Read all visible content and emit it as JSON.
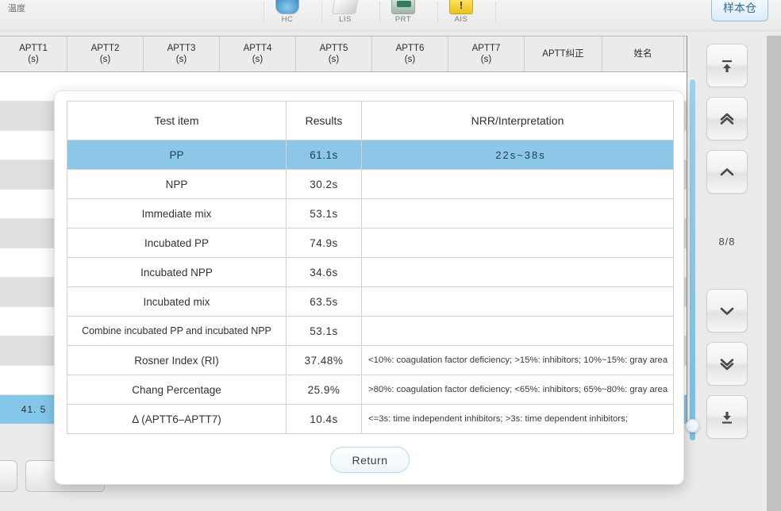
{
  "toolbar": {
    "left_label": "温度",
    "items": [
      {
        "name": "hc-icon",
        "label": "HC"
      },
      {
        "name": "lis-icon",
        "label": "LIS"
      },
      {
        "name": "prt-icon",
        "label": "PRT"
      },
      {
        "name": "ais-icon",
        "label": "AIS"
      }
    ],
    "sample_button": "样本仓"
  },
  "grid": {
    "columns": [
      {
        "line1": "APTT1",
        "line2": "(s)"
      },
      {
        "line1": "APTT2",
        "line2": "(s)"
      },
      {
        "line1": "APTT3",
        "line2": "(s)"
      },
      {
        "line1": "APTT4",
        "line2": "(s)"
      },
      {
        "line1": "APTT5",
        "line2": "(s)"
      },
      {
        "line1": "APTT6",
        "line2": "(s)"
      },
      {
        "line1": "APTT7",
        "line2": "(s)"
      },
      {
        "line1": "APTT纠正",
        "line2": ""
      },
      {
        "line1": "姓名",
        "line2": ""
      }
    ],
    "selected_row_value": "41. 5"
  },
  "rail": {
    "page_indicator": "8/8",
    "buttons": [
      {
        "name": "go-first-button",
        "icon": "arrow-up-to-bar-icon"
      },
      {
        "name": "page-up-button",
        "icon": "double-chevron-up-icon"
      },
      {
        "name": "scroll-up-button",
        "icon": "chevron-up-icon"
      },
      {
        "name": "scroll-down-button",
        "icon": "chevron-down-icon"
      },
      {
        "name": "page-down-button",
        "icon": "double-chevron-down-icon"
      },
      {
        "name": "go-last-button",
        "icon": "arrow-down-to-bar-icon"
      }
    ]
  },
  "dialog": {
    "headers": [
      "Test item",
      "Results",
      "NRR/Interpretation"
    ],
    "rows": [
      {
        "item": "PP",
        "result": "61.1s",
        "nrr": "22s~38s",
        "selected": true,
        "small": false
      },
      {
        "item": "NPP",
        "result": "30.2s",
        "nrr": "",
        "selected": false,
        "small": false
      },
      {
        "item": "Immediate mix",
        "result": "53.1s",
        "nrr": "",
        "selected": false,
        "small": false
      },
      {
        "item": "Incubated PP",
        "result": "74.9s",
        "nrr": "",
        "selected": false,
        "small": false
      },
      {
        "item": "Incubated NPP",
        "result": "34.6s",
        "nrr": "",
        "selected": false,
        "small": false
      },
      {
        "item": "Incubated mix",
        "result": "63.5s",
        "nrr": "",
        "selected": false,
        "small": false
      },
      {
        "item": "Combine incubated PP and incubated NPP",
        "result": "53.1s",
        "nrr": "",
        "selected": false,
        "small": true
      },
      {
        "item": "Rosner  Index (RI)",
        "result": "37.48%",
        "nrr": "<10%: coagulation factor deficiency;  >15%: inhibitors;  10%~15%:  gray area",
        "selected": false,
        "small": false
      },
      {
        "item": "Chang Percentage",
        "result": "25.9%",
        "nrr": ">80%: coagulation factor deficiency;  <65%: inhibitors;  65%~80%:  gray area",
        "selected": false,
        "small": false
      },
      {
        "item": "Δ (APTT6–APTT7)",
        "result": "10.4s",
        "nrr": "<=3s: time independent inhibitors;  >3s: time dependent inhibitors;",
        "selected": false,
        "small": false
      }
    ],
    "return_button": "Return"
  },
  "colors": {
    "selection_blue": "#8cc7e8",
    "grid_selection_blue": "#83c8ea",
    "slider_blue": "#7cc2e6",
    "accent_button_text": "#2f6f93"
  }
}
